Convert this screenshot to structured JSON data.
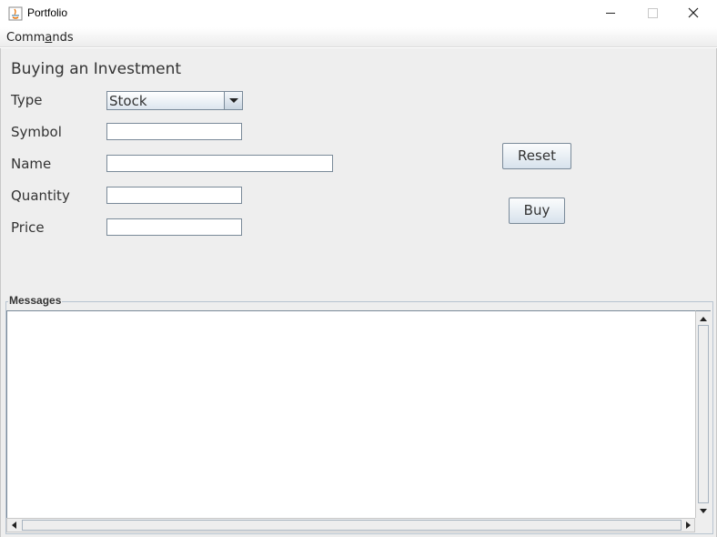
{
  "window": {
    "title": "Portfolio"
  },
  "menubar": {
    "commands": {
      "pre": "Comm",
      "mnemonic": "a",
      "post": "nds"
    }
  },
  "form": {
    "heading": "Buying an Investment",
    "type_label": "Type",
    "type_value": "Stock",
    "symbol_label": "Symbol",
    "symbol_value": "",
    "name_label": "Name",
    "name_value": "",
    "quantity_label": "Quantity",
    "quantity_value": "",
    "price_label": "Price",
    "price_value": ""
  },
  "buttons": {
    "reset": "Reset",
    "buy": "Buy"
  },
  "messages": {
    "title": "Messages",
    "text": ""
  },
  "icons": {
    "app": "java-icon",
    "minimize": "minimize-icon",
    "maximize": "maximize-icon",
    "close": "close-icon"
  }
}
